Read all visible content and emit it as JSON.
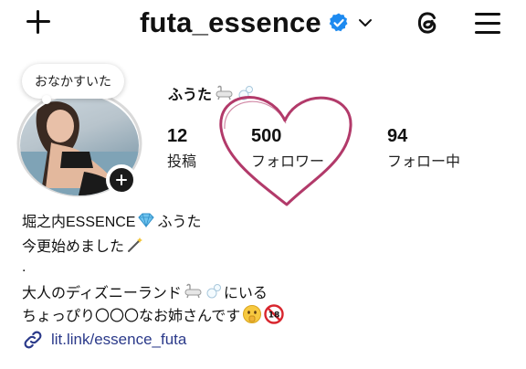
{
  "header": {
    "username": "futa_essence",
    "icons": {
      "create": "plus-icon",
      "verified": "verified-badge-icon",
      "account_switch": "chevron-down-icon",
      "threads": "threads-icon",
      "menu": "hamburger-menu-icon"
    }
  },
  "note": {
    "text": "おなかすいた"
  },
  "profile": {
    "display_name": "ふうた"
  },
  "stats": [
    {
      "value": "12",
      "label": "投稿"
    },
    {
      "value": "500",
      "label": "フォロワー"
    },
    {
      "value": "94",
      "label": "フォロー中"
    }
  ],
  "bio": {
    "line1_a": "堀之内ESSENCE",
    "line1_b": "ふうた",
    "line2": "今更始めました",
    "line3": ".",
    "line4_a": "大人のディズニーランド",
    "line4_b": "にいる",
    "line5": "ちょっぴり〇〇〇なお姉さんです"
  },
  "link": {
    "text": "lit.link/essence_futa"
  },
  "colors": {
    "verified": "#1d8af0",
    "heart": "#b23a6a",
    "link": "#2b3a8a",
    "text": "#111111"
  }
}
